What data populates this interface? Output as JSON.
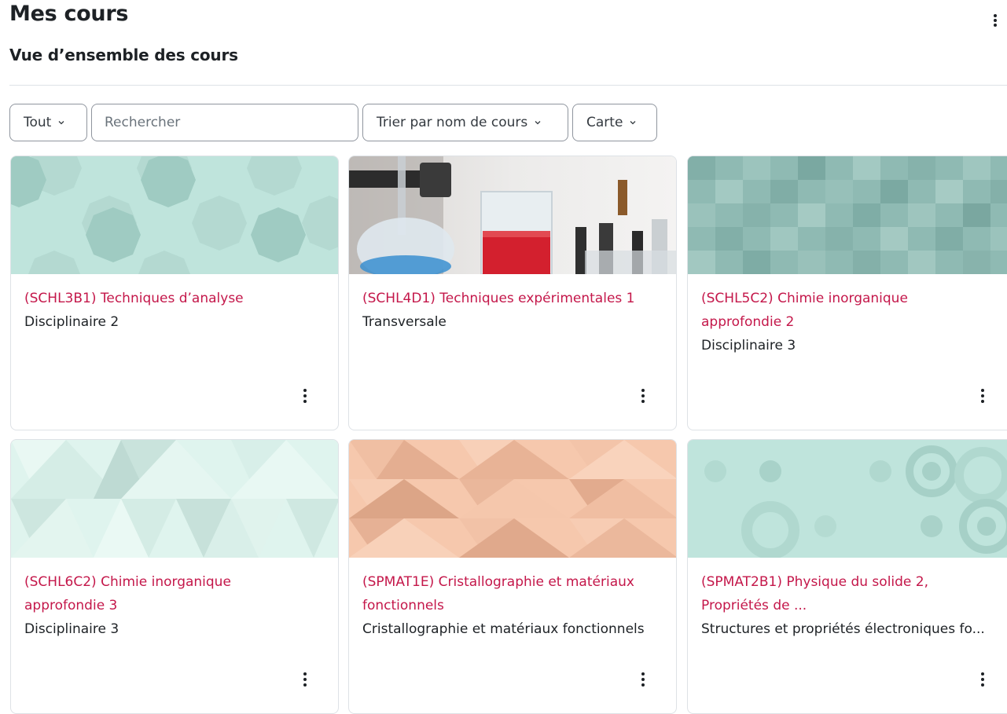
{
  "page": {
    "title": "Mes cours",
    "section_title": "Vue d’ensemble des cours"
  },
  "controls": {
    "filter_label": "Tout",
    "search_placeholder": "Rechercher",
    "sort_label": "Trier par nom de cours",
    "view_label": "Carte"
  },
  "colors": {
    "accent": "#c4174a",
    "text": "#1d2125",
    "border": "#dee2e6"
  },
  "courses": [
    {
      "title": "(SCHL3B1) Techniques d’analyse",
      "category": "Disciplinaire 2",
      "image": "octagon-pattern"
    },
    {
      "title": "(SCHL4D1) Techniques expérimentales 1",
      "category": "Transversale",
      "image": "laboratory-photo"
    },
    {
      "title": "(SCHL5C2) Chimie inorganique approfondie 2",
      "category": "Disciplinaire 3",
      "image": "square-mosaic-pattern"
    },
    {
      "title": "(SCHL6C2) Chimie inorganique approfondie 3",
      "category": "Disciplinaire 3",
      "image": "triangle-pattern"
    },
    {
      "title": "(SPMAT1E) Cristallographie et matériaux fonctionnels",
      "category": "Cristallographie et matériaux fonctionnels",
      "image": "peach-triangle-pattern"
    },
    {
      "title": "(SPMAT2B1) Physique du solide 2, Propriétés de ...",
      "category": "Structures et propriétés électroniques fo...",
      "image": "circles-pattern"
    }
  ]
}
